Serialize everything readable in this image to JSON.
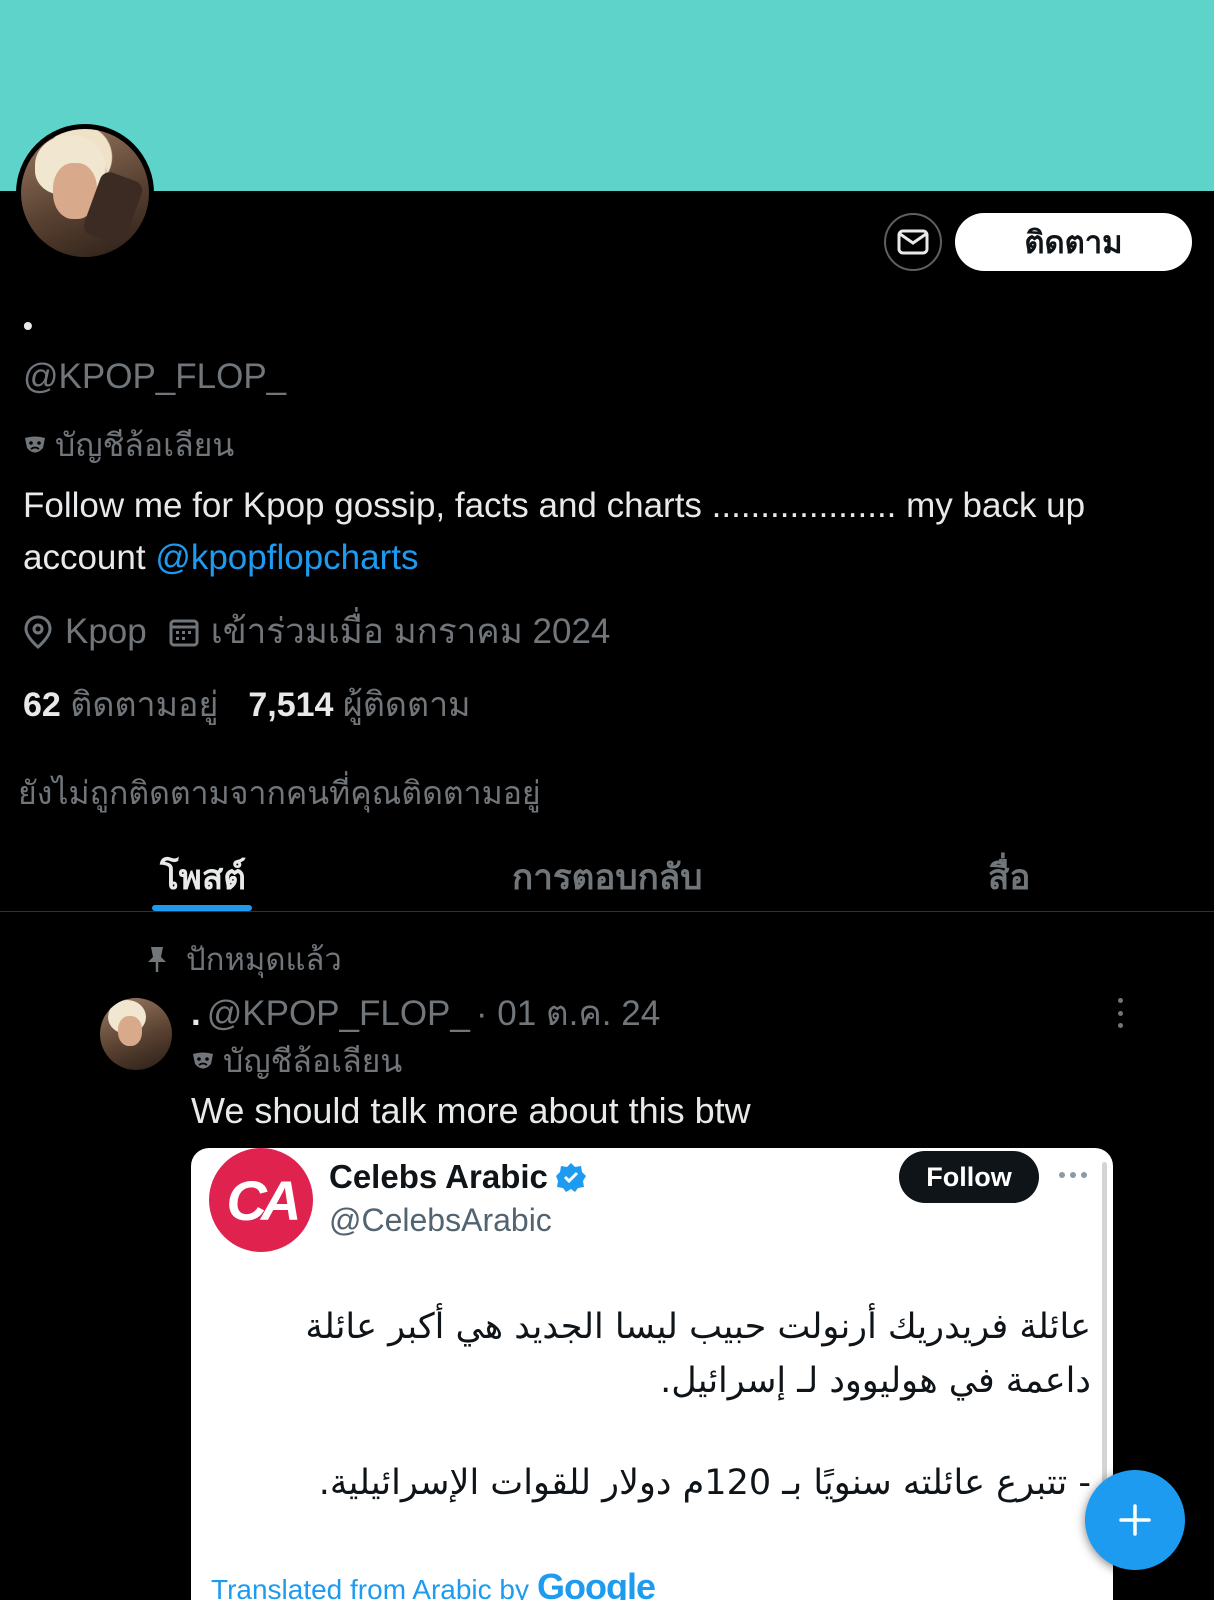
{
  "profile": {
    "display_name": "•",
    "handle": "@KPOP_FLOP_",
    "parody_label": "บัญชีล้อเลียน",
    "bio_text": "Follow me for Kpop gossip, facts and charts ................... my back up account ",
    "bio_link": "@kpopflopcharts",
    "location": "Kpop",
    "joined": "เข้าร่วมเมื่อ มกราคม 2024",
    "following_count": "62",
    "following_label": "ติดตามอยู่",
    "followers_count": "7,514",
    "followers_label": "ผู้ติดตาม",
    "not_followed_note": "ยังไม่ถูกติดตามจากคนที่คุณติดตามอยู่"
  },
  "actions": {
    "follow_label": "ติดตาม"
  },
  "tabs": [
    {
      "label": "โพสต์",
      "active": true
    },
    {
      "label": "การตอบกลับ",
      "active": false
    },
    {
      "label": "สื่อ",
      "active": false
    }
  ],
  "post": {
    "pinned_label": "ปักหมุดแล้ว",
    "author_name": ".",
    "author_handle": "@KPOP_FLOP_",
    "date": "· 01 ต.ค. 24",
    "parody_label": "บัญชีล้อเลียน",
    "text": "We should talk more about this btw",
    "embed": {
      "logo_text": "CA",
      "name": "Celebs Arabic",
      "handle": "@CelebsArabic",
      "follow_label": "Follow",
      "arabic_line1": "عائلة فريدريك أرنولت حبيب ليسا الجديد هي أكبر عائلة داعمة في هوليوود لـ إسرائيل.",
      "arabic_line2": "- تتبرع عائلته سنويًا بـ 120م دولار للقوات الإسرائيلية.",
      "translated_label": "Translated from Arabic by",
      "google": "Google"
    }
  },
  "colors": {
    "banner": "#5dd3c9",
    "accent": "#1d9bf0",
    "background": "#000000",
    "muted_text": "#71767b"
  }
}
